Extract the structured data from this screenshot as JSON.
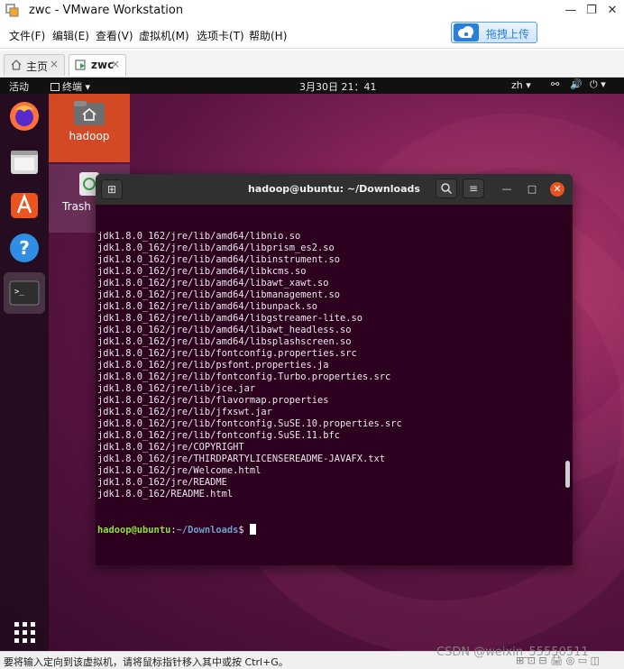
{
  "window": {
    "title": "zwc - VMware Workstation",
    "controls": {
      "minimize": "—",
      "restore": "❐",
      "close": "✕"
    }
  },
  "menubar": {
    "items": [
      "文件(F)",
      "编辑(E)",
      "查看(V)",
      "虚拟机(M)",
      "选项卡(T)",
      "帮助(H)"
    ],
    "upload_label": "拖拽上传"
  },
  "tabs": [
    {
      "label": "主页",
      "close": "×"
    },
    {
      "label": "zwc",
      "close": "×"
    }
  ],
  "ubuntu": {
    "activities": "活动",
    "app_menu": "终端 ▾",
    "clock": "3月30日  21：41",
    "lang": "zh ▾",
    "sys_icons": {
      "network": "⚯",
      "volume": "🔊",
      "power": "⏻ ▾"
    }
  },
  "desktop": {
    "icons": [
      {
        "label": "hadoop"
      },
      {
        "label": "Trash"
      }
    ]
  },
  "terminal": {
    "title": "hadoop@ubuntu: ~/Downloads",
    "lines": [
      "jdk1.8.0_162/jre/lib/amd64/libnio.so",
      "jdk1.8.0_162/jre/lib/amd64/libprism_es2.so",
      "jdk1.8.0_162/jre/lib/amd64/libinstrument.so",
      "jdk1.8.0_162/jre/lib/amd64/libkcms.so",
      "jdk1.8.0_162/jre/lib/amd64/libawt_xawt.so",
      "jdk1.8.0_162/jre/lib/amd64/libmanagement.so",
      "jdk1.8.0_162/jre/lib/amd64/libunpack.so",
      "jdk1.8.0_162/jre/lib/amd64/libgstreamer-lite.so",
      "jdk1.8.0_162/jre/lib/amd64/libawt_headless.so",
      "jdk1.8.0_162/jre/lib/amd64/libsplashscreen.so",
      "jdk1.8.0_162/jre/lib/fontconfig.properties.src",
      "jdk1.8.0_162/jre/lib/psfont.properties.ja",
      "jdk1.8.0_162/jre/lib/fontconfig.Turbo.properties.src",
      "jdk1.8.0_162/jre/lib/jce.jar",
      "jdk1.8.0_162/jre/lib/flavormap.properties",
      "jdk1.8.0_162/jre/lib/jfxswt.jar",
      "jdk1.8.0_162/jre/lib/fontconfig.SuSE.10.properties.src",
      "jdk1.8.0_162/jre/lib/fontconfig.SuSE.11.bfc",
      "jdk1.8.0_162/jre/COPYRIGHT",
      "jdk1.8.0_162/jre/THIRDPARTYLICENSEREADME-JAVAFX.txt",
      "jdk1.8.0_162/jre/Welcome.html",
      "jdk1.8.0_162/jre/README",
      "jdk1.8.0_162/README.html"
    ],
    "prompt_user": "hadoop@ubuntu",
    "prompt_sep": ":",
    "prompt_path": "~/Downloads",
    "prompt_symbol": "$ "
  },
  "statusbar": {
    "message": "要将输入定向到该虚拟机，请将鼠标指针移入其中或按 Ctrl+G。",
    "icons": "⊞ ⊡ ⊟ 🖨 ◎ ▭ ◫"
  },
  "watermark": "CSDN @weixin_55550511",
  "colors": {
    "ubuntu_orange": "#e95420",
    "terminal_bg": "#2c001e",
    "prompt_green": "#8ae234",
    "prompt_blue": "#729fcf"
  }
}
